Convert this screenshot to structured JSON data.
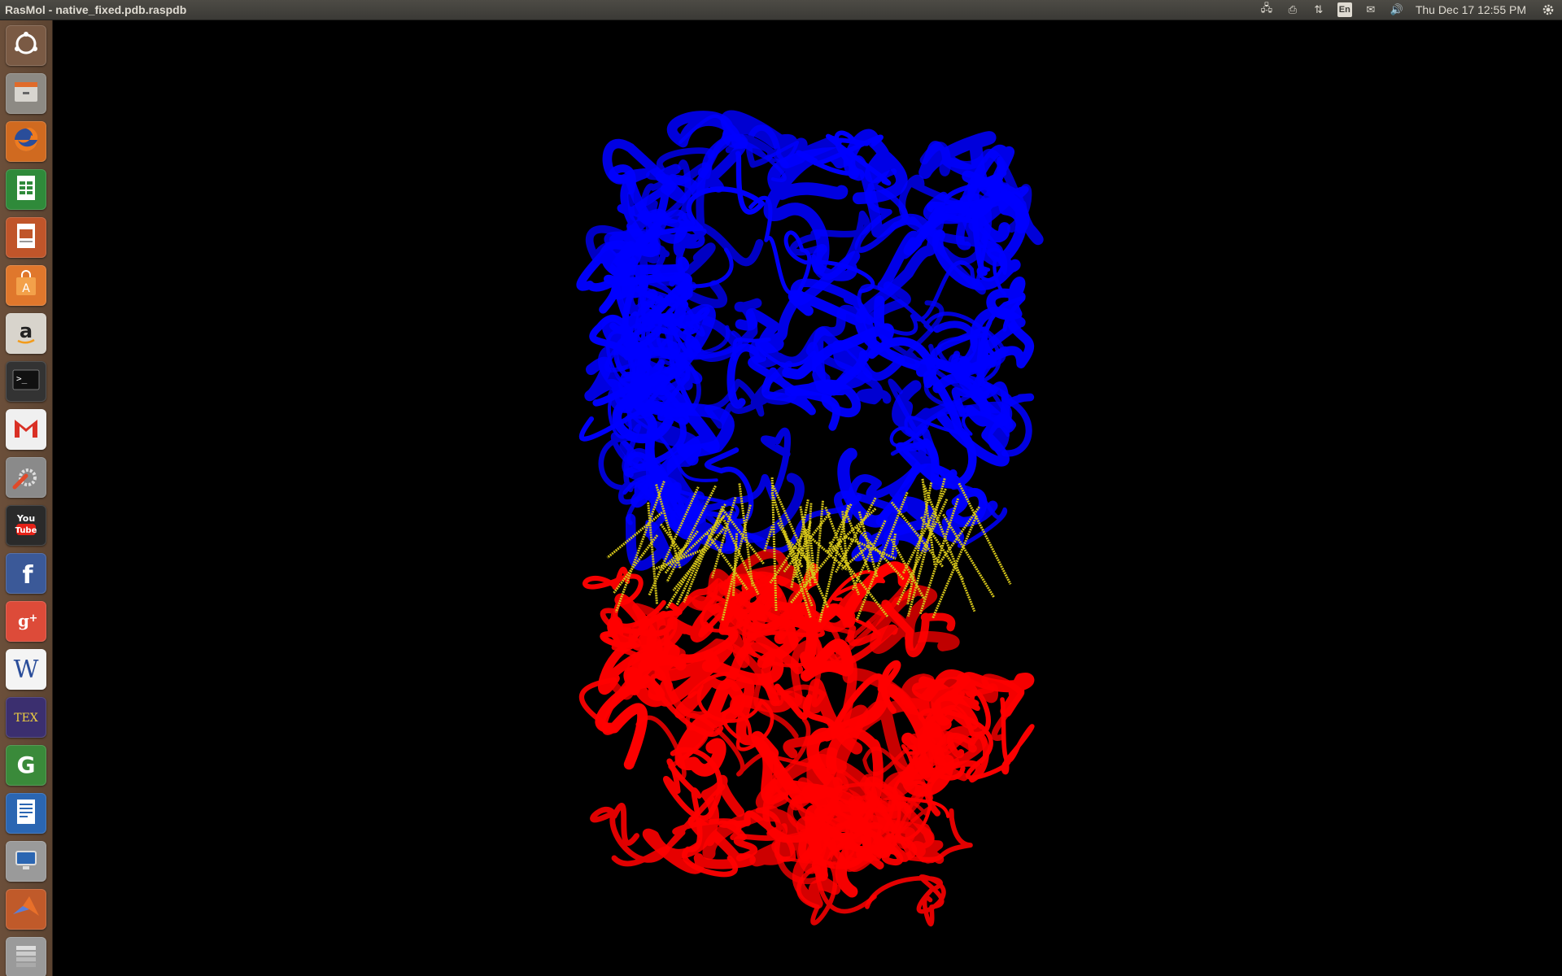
{
  "window": {
    "title": "RasMol - native_fixed.pdb.raspdb"
  },
  "panel": {
    "indicators": [
      {
        "name": "network-icon",
        "glyph": "🖧"
      },
      {
        "name": "printer-icon",
        "glyph": "⎙"
      },
      {
        "name": "transfer-icon",
        "glyph": "⇅"
      },
      {
        "name": "keyboard-layout",
        "glyph": "En"
      },
      {
        "name": "mail-icon",
        "glyph": "✉"
      },
      {
        "name": "volume-icon",
        "glyph": "🔊"
      }
    ],
    "clock": "Thu Dec 17 12:55 PM",
    "session_icon": "gear-icon"
  },
  "launcher": {
    "items": [
      {
        "name": "dash-home",
        "icon": "ubuntu-logo-icon",
        "color": "#7a5a44"
      },
      {
        "name": "files",
        "icon": "file-cabinet-icon",
        "color": "#8d8a84"
      },
      {
        "name": "firefox",
        "icon": "firefox-icon",
        "color": "#d06a20"
      },
      {
        "name": "libreoffice-calc",
        "icon": "spreadsheet-icon",
        "color": "#2f8a3a"
      },
      {
        "name": "libreoffice-impress",
        "icon": "presentation-icon",
        "color": "#c0552a"
      },
      {
        "name": "software-center",
        "icon": "shopping-bag-icon",
        "color": "#e0772c"
      },
      {
        "name": "amazon",
        "icon": "amazon-icon",
        "color": "#d8d4cc"
      },
      {
        "name": "terminal",
        "icon": "terminal-icon",
        "color": "#333333"
      },
      {
        "name": "gmail",
        "icon": "gmail-icon",
        "color": "#f0f0f0"
      },
      {
        "name": "system-settings",
        "icon": "wrench-gear-icon",
        "color": "#8a8a8a"
      },
      {
        "name": "youtube",
        "icon": "youtube-icon",
        "color": "#2a2a2a",
        "label": "You Tube"
      },
      {
        "name": "facebook",
        "icon": "facebook-icon",
        "color": "#3b5998"
      },
      {
        "name": "google-plus",
        "icon": "google-plus-icon",
        "color": "#dd4b39"
      },
      {
        "name": "wordpress-writer",
        "icon": "w-letter-icon",
        "color": "#f4f4f4"
      },
      {
        "name": "texmaker",
        "icon": "tex-icon",
        "color": "#3b2f6f"
      },
      {
        "name": "gnumeric",
        "icon": "g-letter-icon",
        "color": "#3a8a3a"
      },
      {
        "name": "libreoffice-writer",
        "icon": "document-icon",
        "color": "#2b66b2"
      },
      {
        "name": "remote-desktop",
        "icon": "monitor-icon",
        "color": "#9a9a9a"
      },
      {
        "name": "matlab",
        "icon": "matlab-icon",
        "color": "#c05a2a"
      },
      {
        "name": "workspaces",
        "icon": "stack-icon",
        "color": "#9a9a9a"
      }
    ]
  },
  "molecule": {
    "chains": [
      {
        "name": "chain-a-ribbon",
        "color": "#0000ff"
      },
      {
        "name": "chain-b-ribbon",
        "color": "#ff0000"
      }
    ],
    "contacts_color": "#d4c41a",
    "background": "#000000"
  }
}
